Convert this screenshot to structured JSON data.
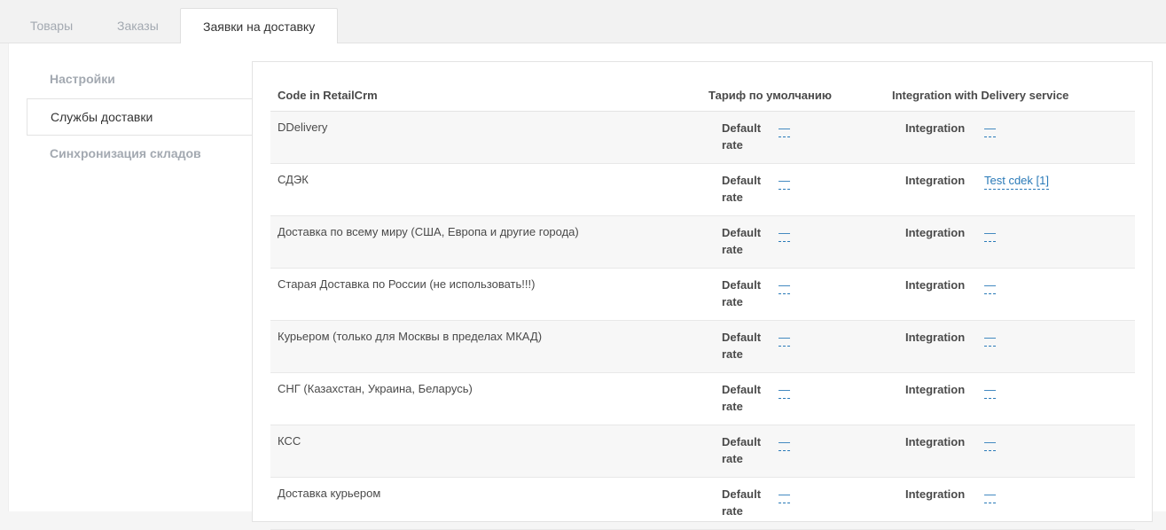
{
  "tabs": [
    {
      "label": "Товары",
      "active": false
    },
    {
      "label": "Заказы",
      "active": false
    },
    {
      "label": "Заявки на доставку",
      "active": true
    }
  ],
  "sidebar": {
    "items": [
      {
        "label": "Настройки",
        "active": false
      },
      {
        "label": "Службы доставки",
        "active": true
      },
      {
        "label": "Синхронизация складов",
        "active": false
      }
    ]
  },
  "table": {
    "headers": [
      "Code in RetailCrm",
      "Тариф по умолчанию",
      "Integration with Delivery service"
    ],
    "rate_label": "Default rate",
    "integration_label": "Integration",
    "rows": [
      {
        "code": "DDelivery",
        "rate": "—",
        "integration": "—"
      },
      {
        "code": "СДЭК",
        "rate": "—",
        "integration": "Test cdek [1]"
      },
      {
        "code": "Доставка по всему миру (США, Европа и другие города)",
        "rate": "—",
        "integration": "—"
      },
      {
        "code": "Старая Доставка по России (не использовать!!!)",
        "rate": "—",
        "integration": "—"
      },
      {
        "code": "Курьером (только для Москвы в пределах МКАД)",
        "rate": "—",
        "integration": "—"
      },
      {
        "code": "СНГ (Казахстан, Украина, Беларусь)",
        "rate": "—",
        "integration": "—"
      },
      {
        "code": "КСС",
        "rate": "—",
        "integration": "—"
      },
      {
        "code": "Доставка курьером",
        "rate": "—",
        "integration": "—"
      }
    ]
  },
  "colors": {
    "link": "#2a7ab8",
    "muted": "#a3a9b1"
  }
}
